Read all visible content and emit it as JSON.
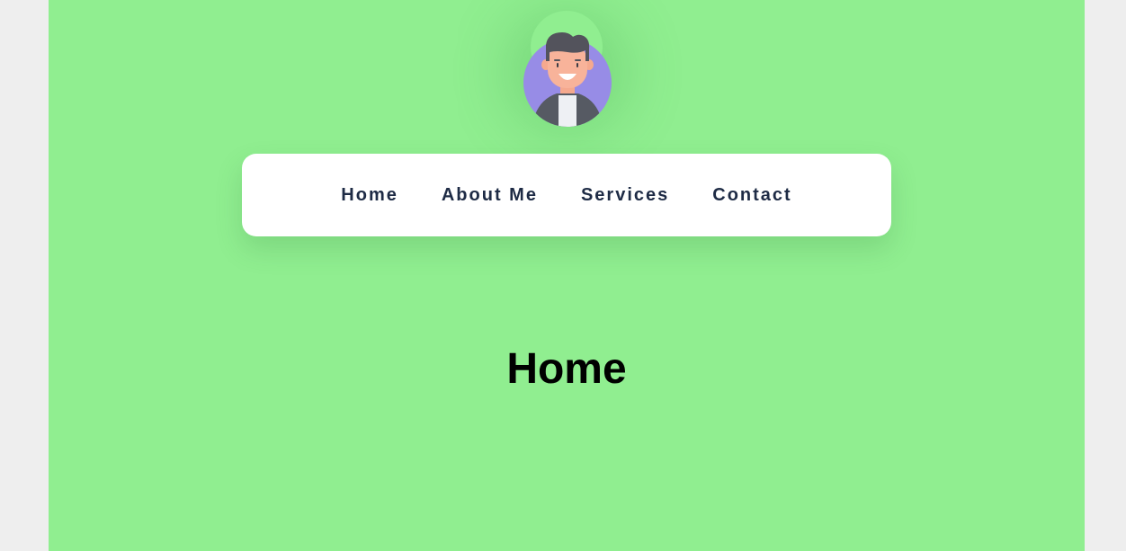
{
  "nav": {
    "items": [
      {
        "label": "Home"
      },
      {
        "label": "About Me"
      },
      {
        "label": "Services"
      },
      {
        "label": "Contact"
      }
    ]
  },
  "main": {
    "heading": "Home"
  },
  "colors": {
    "page_background": "#90ee90",
    "outer_background": "#eeeeee",
    "nav_card": "#ffffff",
    "nav_text": "#1e2b45",
    "avatar_circle": "#978ce6"
  },
  "avatar": {
    "icon": "user-avatar-icon"
  }
}
